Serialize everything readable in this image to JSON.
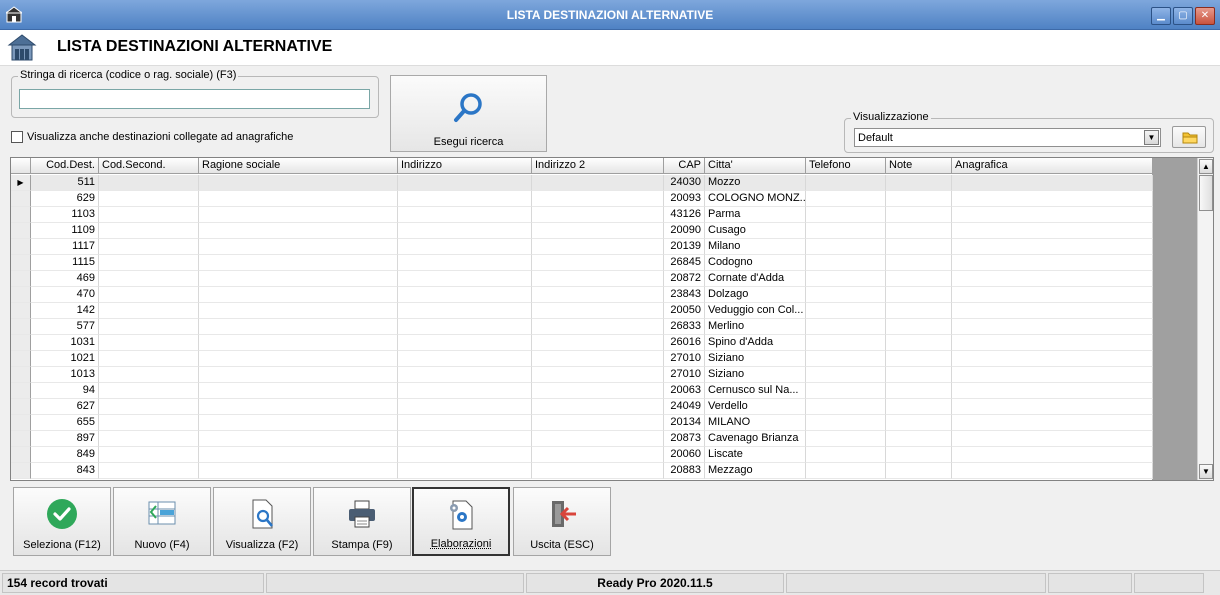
{
  "window": {
    "title": "LISTA DESTINAZIONI ALTERNATIVE"
  },
  "header": {
    "title": "LISTA DESTINAZIONI ALTERNATIVE"
  },
  "search": {
    "group_label": "Stringa di ricerca (codice o rag. sociale) (F3)",
    "value": "",
    "checkbox_label": "Visualizza anche destinazioni collegate ad anagrafiche",
    "button_label": "Esegui ricerca"
  },
  "view": {
    "group_label": "Visualizzazione",
    "selected": "Default"
  },
  "grid": {
    "columns": [
      "Cod.Dest.",
      "Cod.Second.",
      "Ragione sociale",
      "Indirizzo",
      "Indirizzo 2",
      "CAP",
      "Citta'",
      "Telefono",
      "Note",
      "Anagrafica"
    ],
    "rows": [
      {
        "cod": "511",
        "cap": "24030",
        "citta": "Mozzo"
      },
      {
        "cod": "629",
        "cap": "20093",
        "citta": "COLOGNO MONZ..."
      },
      {
        "cod": "1103",
        "cap": "43126",
        "citta": "Parma"
      },
      {
        "cod": "1109",
        "cap": "20090",
        "citta": "Cusago"
      },
      {
        "cod": "1117",
        "cap": "20139",
        "citta": "Milano"
      },
      {
        "cod": "1115",
        "cap": "26845",
        "citta": "Codogno"
      },
      {
        "cod": "469",
        "cap": "20872",
        "citta": "Cornate d'Adda"
      },
      {
        "cod": "470",
        "cap": "23843",
        "citta": "Dolzago"
      },
      {
        "cod": "142",
        "cap": "20050",
        "citta": "Veduggio con Col..."
      },
      {
        "cod": "577",
        "cap": "26833",
        "citta": "Merlino"
      },
      {
        "cod": "1031",
        "cap": "26016",
        "citta": "Spino d'Adda"
      },
      {
        "cod": "1021",
        "cap": "27010",
        "citta": "Siziano"
      },
      {
        "cod": "1013",
        "cap": "27010",
        "citta": "Siziano"
      },
      {
        "cod": "94",
        "cap": "20063",
        "citta": "Cernusco sul Na..."
      },
      {
        "cod": "627",
        "cap": "24049",
        "citta": "Verdello"
      },
      {
        "cod": "655",
        "cap": "20134",
        "citta": "MILANO"
      },
      {
        "cod": "897",
        "cap": "20873",
        "citta": "Cavenago Brianza"
      },
      {
        "cod": "849",
        "cap": "20060",
        "citta": "Liscate"
      },
      {
        "cod": "843",
        "cap": "20883",
        "citta": "Mezzago"
      }
    ]
  },
  "toolbar": {
    "select_label": "Seleziona (F12)",
    "new_label": "Nuovo (F4)",
    "view_label": "Visualizza (F2)",
    "print_label": "Stampa (F9)",
    "process_label": "Elaborazioni",
    "exit_label": "Uscita (ESC)"
  },
  "status": {
    "records": "154 record trovati",
    "version": "Ready Pro 2020.11.5"
  },
  "colors": {
    "titlebar": "#5b8bcc",
    "accent_green": "#2fa85a",
    "search_blue": "#2b76c6",
    "exit_red": "#d9443b"
  }
}
